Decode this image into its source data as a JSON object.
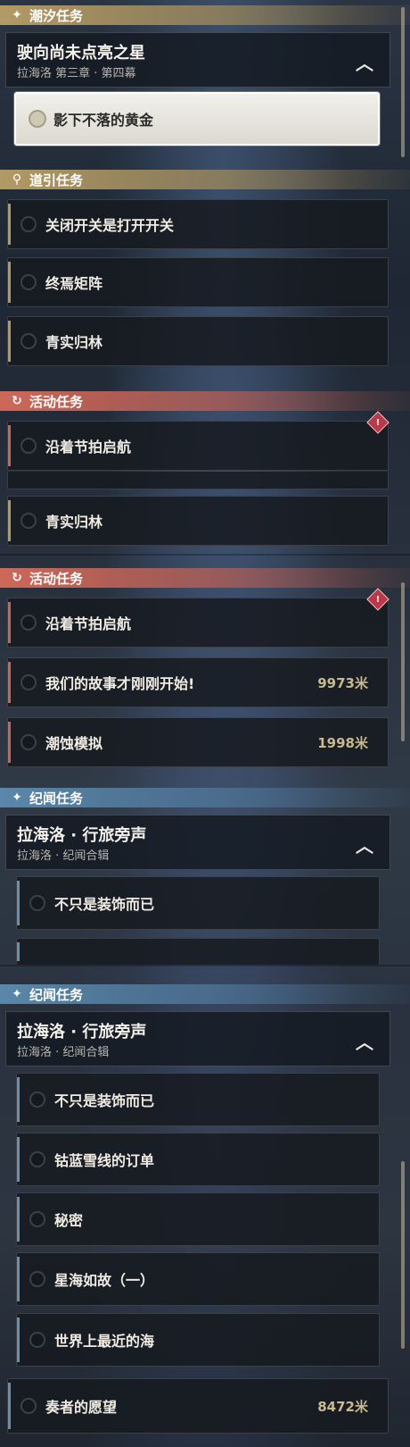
{
  "colors": {
    "gold": "#b39a64",
    "red": "#c8645a",
    "blue": "#6a90b0",
    "distance": "#c8b98e"
  },
  "section1": {
    "header": "潮汐任务",
    "icon": "star-icon",
    "group_title": "驶向尚未点亮之星",
    "group_subtitle": "拉海洛 第三章 · 第四幕",
    "selected_item": "影下不落的黄金"
  },
  "section2": {
    "header": "道引任务",
    "icon": "location-pin-icon",
    "items": [
      "关闭开关是打开开关",
      "终焉矩阵",
      "青实归林"
    ]
  },
  "section3": {
    "header": "活动任务",
    "icon": "event-icon",
    "items": [
      "沿着节拍启航"
    ],
    "partial_item": "青实归林"
  },
  "section4": {
    "header": "活动任务",
    "icon": "event-icon",
    "items": [
      {
        "label": "沿着节拍启航",
        "distance": ""
      },
      {
        "label": "我们的故事才刚刚开始!",
        "distance": "9973米"
      },
      {
        "label": "潮蚀模拟",
        "distance": "1998米"
      }
    ]
  },
  "section5": {
    "header": "纪闻任务",
    "icon": "star-icon",
    "group_title": "拉海洛 · 行旅旁声",
    "group_subtitle": "拉海洛 · 纪闻合辑",
    "items": [
      "不只是装饰而已"
    ]
  },
  "section6": {
    "header": "纪闻任务",
    "icon": "star-icon",
    "group_title": "拉海洛 · 行旅旁声",
    "group_subtitle": "拉海洛 · 纪闻合辑",
    "items": [
      "不只是装饰而已",
      "钴蓝雪线的订单",
      "秘密",
      "星海如故（一）",
      "世界上最近的海"
    ],
    "extra_item": {
      "label": "奏者的愿望",
      "distance": "8472米"
    }
  }
}
